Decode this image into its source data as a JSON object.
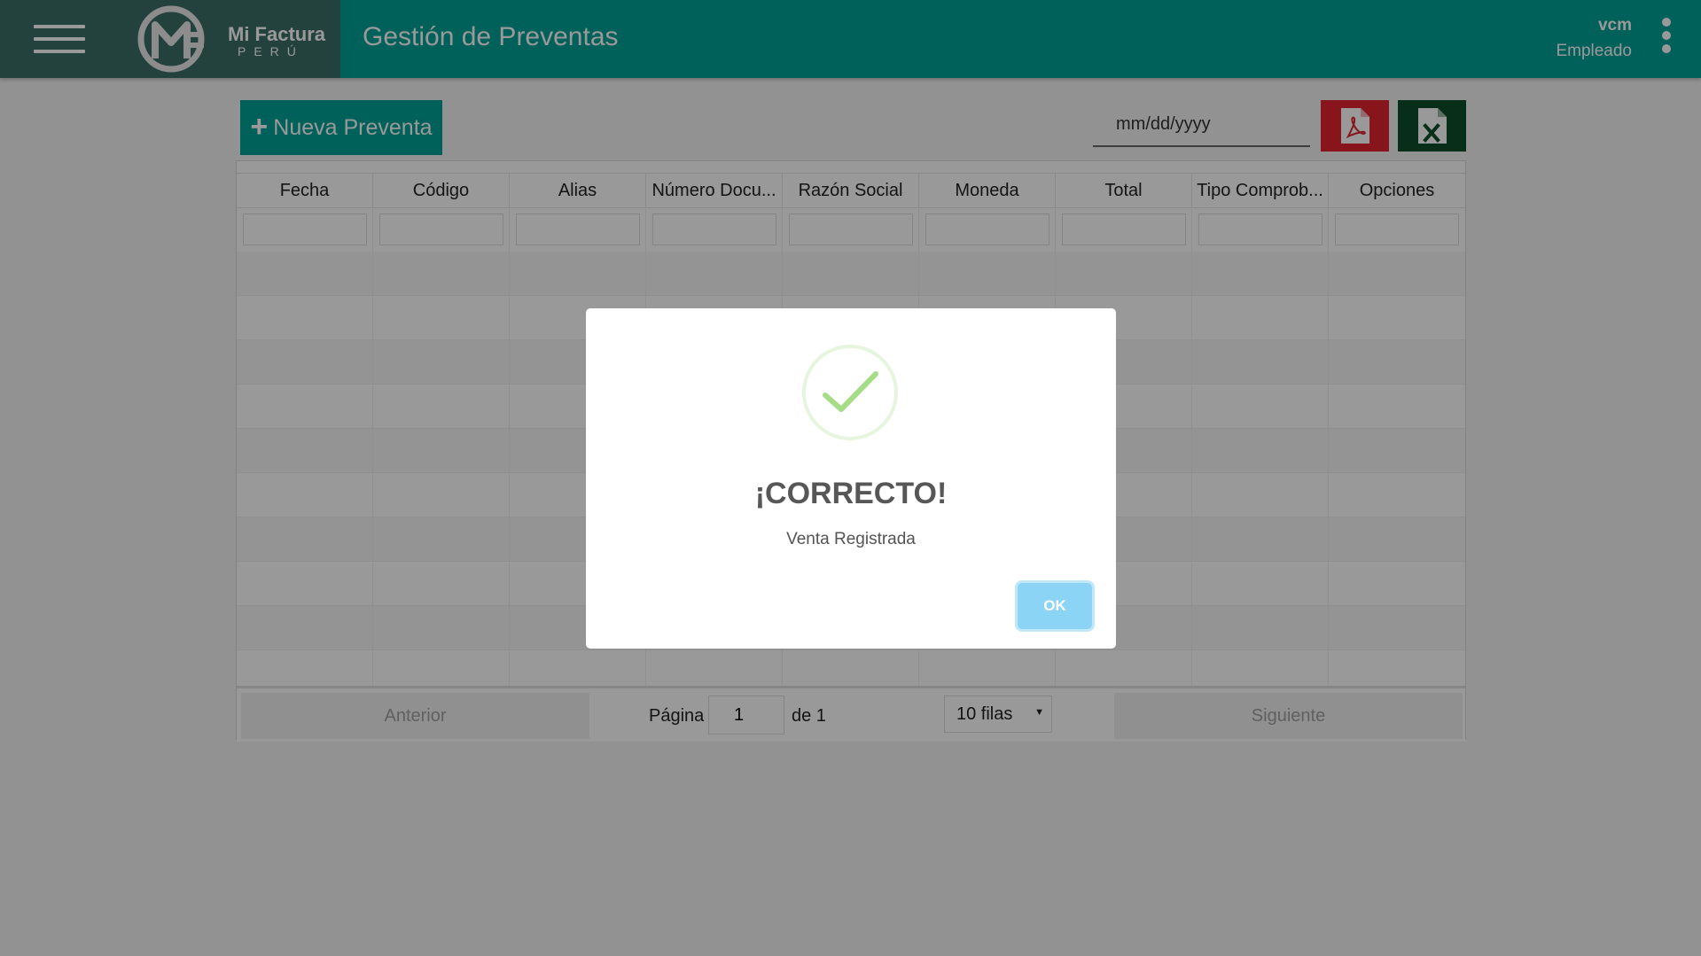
{
  "header": {
    "brand_line1": "Mi Factura",
    "brand_line2": "PERÚ",
    "title": "Gestión de Preventas",
    "user_name": "vcm",
    "user_role": "Empleado"
  },
  "toolbar": {
    "new_label": "Nueva Preventa",
    "date_placeholder": "mm/dd/yyyy",
    "pdf_icon": "pdf-icon",
    "excel_icon": "excel-icon"
  },
  "table": {
    "columns": [
      "Fecha",
      "Código",
      "Alias",
      "Número Docu...",
      "Razón Social",
      "Moneda",
      "Total",
      "Tipo Comprob...",
      "Opciones"
    ]
  },
  "pagination": {
    "prev_label": "Anterior",
    "next_label": "Siguiente",
    "page_label": "Página",
    "page_value": "1",
    "of_label": "de 1",
    "rows_label": "10 filas"
  },
  "modal": {
    "title": "¡CORRECTO!",
    "text": "Venta Registrada",
    "ok_label": "OK",
    "icon": "success-check-icon"
  },
  "colors": {
    "header": "#00a097",
    "logo_block": "#3b6e68",
    "pdf": "#e1242e",
    "excel": "#0b4d2a",
    "ok_button": "#8cd4f5",
    "success": "#a5dc86"
  }
}
